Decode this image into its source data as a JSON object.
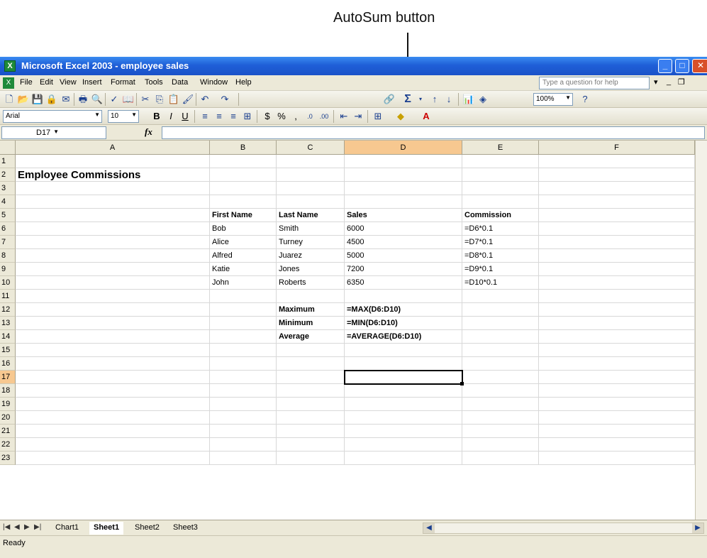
{
  "annotation": {
    "label": "AutoSum button"
  },
  "window": {
    "title": "Microsoft Excel 2003 - employee sales"
  },
  "menu": {
    "items": [
      "File",
      "Edit",
      "View",
      "Insert",
      "Format",
      "Tools",
      "Data",
      "Window",
      "Help"
    ],
    "help_placeholder": "Type a question for help"
  },
  "toolbar": {
    "autosum_glyph": "Σ",
    "zoom": "100%",
    "font_name": "Arial",
    "font_size": "10"
  },
  "formula_bar": {
    "name_box": "D17",
    "fx": "fx",
    "formula": ""
  },
  "columns": [
    "A",
    "B",
    "C",
    "D",
    "E",
    "F"
  ],
  "active_column": "D",
  "active_row": "17",
  "rows": [
    "1",
    "2",
    "3",
    "4",
    "5",
    "6",
    "7",
    "8",
    "9",
    "10",
    "11",
    "12",
    "13",
    "14",
    "15",
    "16",
    "17",
    "18",
    "19",
    "20",
    "21",
    "22",
    "23"
  ],
  "cells": {
    "A2": "Employee Commissions",
    "B5": "First Name",
    "C5": "Last Name",
    "D5": "Sales",
    "E5": "Commission",
    "B6": "Bob",
    "C6": "Smith",
    "D6": "6000",
    "E6": "=D6*0.1",
    "B7": "Alice",
    "C7": "Turney",
    "D7": "4500",
    "E7": "=D7*0.1",
    "B8": "Alfred",
    "C8": "Juarez",
    "D8": "5000",
    "E8": "=D8*0.1",
    "B9": "Katie",
    "C9": "Jones",
    "D9": "7200",
    "E9": "=D9*0.1",
    "B10": "John",
    "C10": "Roberts",
    "D10": "6350",
    "E10": "=D10*0.1",
    "C12": "Maximum",
    "D12": "=MAX(D6:D10)",
    "C13": "Minimum",
    "D13": "=MIN(D6:D10)",
    "C14": "Average",
    "D14": "=AVERAGE(D6:D10)"
  },
  "sheets": [
    "Chart1",
    "Sheet1",
    "Sheet2",
    "Sheet3"
  ],
  "active_sheet": "Sheet1",
  "status": "Ready"
}
